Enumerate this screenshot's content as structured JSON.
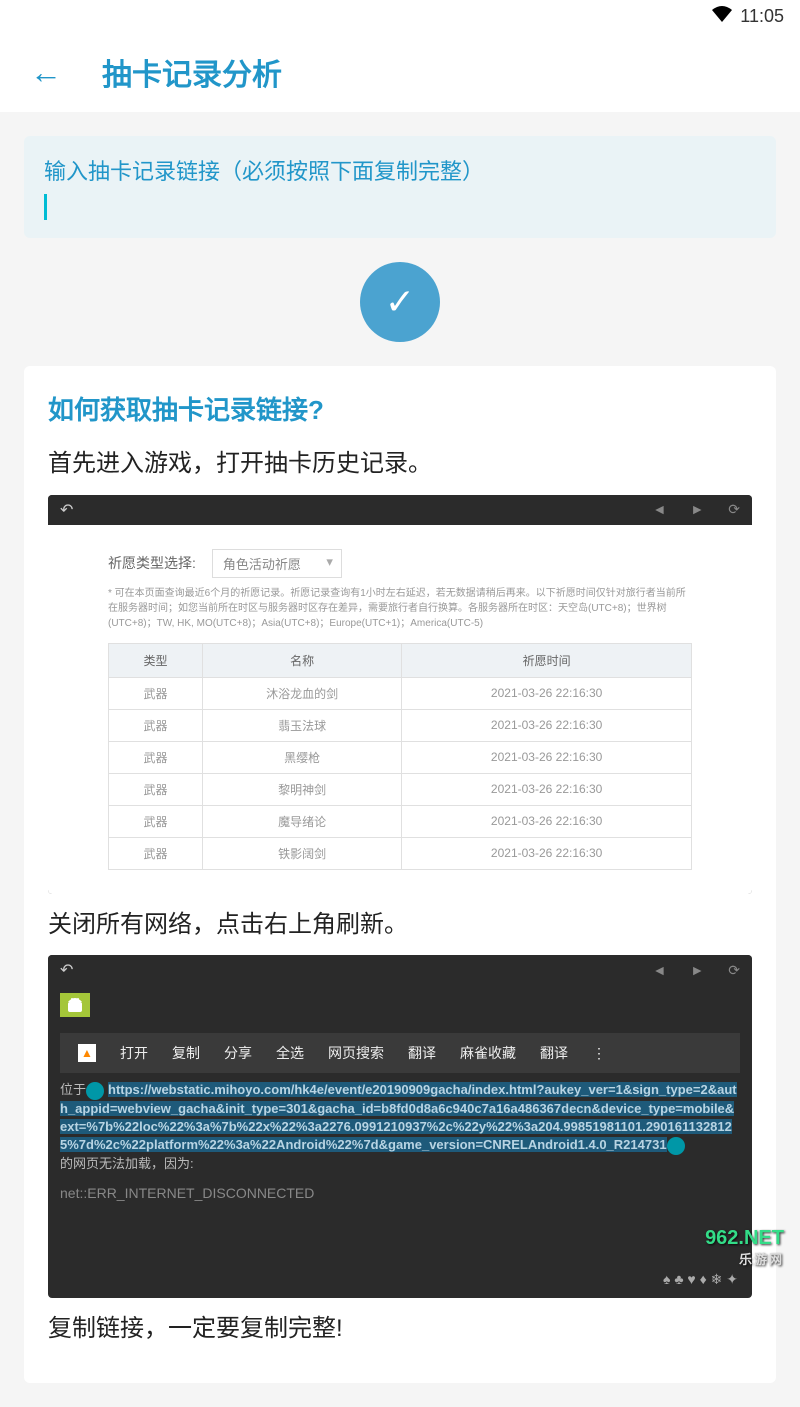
{
  "status": {
    "time": "11:05"
  },
  "header": {
    "title": "抽卡记录分析"
  },
  "input": {
    "label": "输入抽卡记录链接（必须按照下面复制完整）"
  },
  "help": {
    "title": "如何获取抽卡记录链接?",
    "step1": "首先进入游戏，打开抽卡历史记录。",
    "step2": "关闭所有网络，点击右上角刷新。",
    "step3": "复制链接，一定要复制完整!"
  },
  "gacha": {
    "filter_label": "祈愿类型选择:",
    "filter_value": "角色活动祈愿",
    "disclaimer": "* 可在本页面查询最近6个月的祈愿记录。祈愿记录查询有1小时左右延迟，若无数据请稍后再来。以下祈愿时间仅针对旅行者当前所在服务器时间；如您当前所在时区与服务器时区存在差异，需要旅行者自行换算。各服务器所在时区：天空岛(UTC+8)；世界树(UTC+8)；TW, HK, MO(UTC+8)；Asia(UTC+8)；Europe(UTC+1)；America(UTC-5)",
    "headers": {
      "type": "类型",
      "name": "名称",
      "time": "祈愿时间"
    },
    "rows": [
      {
        "type": "武器",
        "name": "沐浴龙血的剑",
        "time": "2021-03-26 22:16:30"
      },
      {
        "type": "武器",
        "name": "翡玉法球",
        "time": "2021-03-26 22:16:30"
      },
      {
        "type": "武器",
        "name": "黑缨枪",
        "time": "2021-03-26 22:16:30"
      },
      {
        "type": "武器",
        "name": "黎明神剑",
        "time": "2021-03-26 22:16:30"
      },
      {
        "type": "武器",
        "name": "魔导绪论",
        "time": "2021-03-26 22:16:30"
      },
      {
        "type": "武器",
        "name": "铁影阔剑",
        "time": "2021-03-26 22:16:30"
      }
    ]
  },
  "browser": {
    "menu": {
      "open": "打开",
      "copy": "复制",
      "share": "分享",
      "select_all": "全选",
      "web_search": "网页搜索",
      "translate": "翻译",
      "collect": "麻雀收藏",
      "translate2": "翻译"
    },
    "prefix": "位于",
    "url": "https://webstatic.mihoyo.com/hk4e/event/e20190909gacha/index.html?aukey_ver=1&sign_type=2&auth_appid=webview_gacha&init_type=301&gacha_id=b8fd0d8a6c940c7a16a486367decn&device_type=mobile&ext=%7b%22loc%22%3a%7b%22x%22%3a2276.0991210937%2c%22y%22%3a204.99851981101.2901611328125%7d%2c%22platform%22%3a%22Android%22%7d&game_version=CNRELAndroid1.4.0_R214731",
    "err_label": "的网页无法加载，因为:",
    "err_code": "net::ERR_INTERNET_DISCONNECTED"
  },
  "watermark": {
    "main": "962.NET",
    "sub": "乐游网"
  }
}
